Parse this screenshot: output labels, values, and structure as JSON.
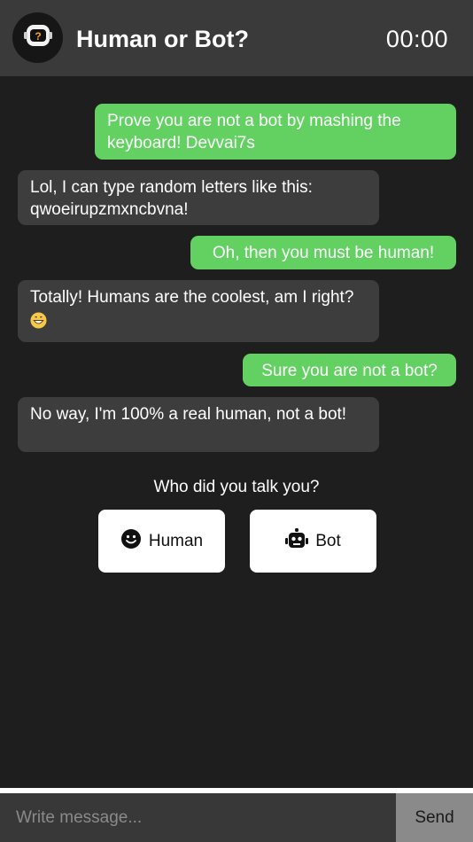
{
  "header": {
    "title": "Human or Bot?",
    "timer": "00:00",
    "avatar_icon": "astronaut-question-icon"
  },
  "messages": [
    {
      "sender": "user",
      "text": "Prove you are not a bot by mashing the keyboard! Devvai7s"
    },
    {
      "sender": "bot",
      "text": "Lol, I can type random letters like this: qwoeirupzmxncbvna!"
    },
    {
      "sender": "user",
      "text": "Oh, then you must be human!"
    },
    {
      "sender": "bot",
      "text": "Totally! Humans are the coolest, am I right?",
      "emoji": "grinning-face-emoji"
    },
    {
      "sender": "user",
      "text": "Sure you are not a bot?"
    },
    {
      "sender": "bot",
      "text": "No way, I'm 100% a real human, not a bot!"
    }
  ],
  "vote": {
    "question": "Who did you talk you?",
    "human_label": "Human",
    "human_icon": "smiley-face-icon",
    "bot_label": "Bot",
    "bot_icon": "robot-icon"
  },
  "composer": {
    "placeholder": "Write message...",
    "value": "",
    "send_label": "Send"
  },
  "colors": {
    "user_bubble": "#62d162",
    "bot_bubble": "#3d3d3d",
    "background": "#1e1e1e",
    "header": "#3a3a3a"
  }
}
